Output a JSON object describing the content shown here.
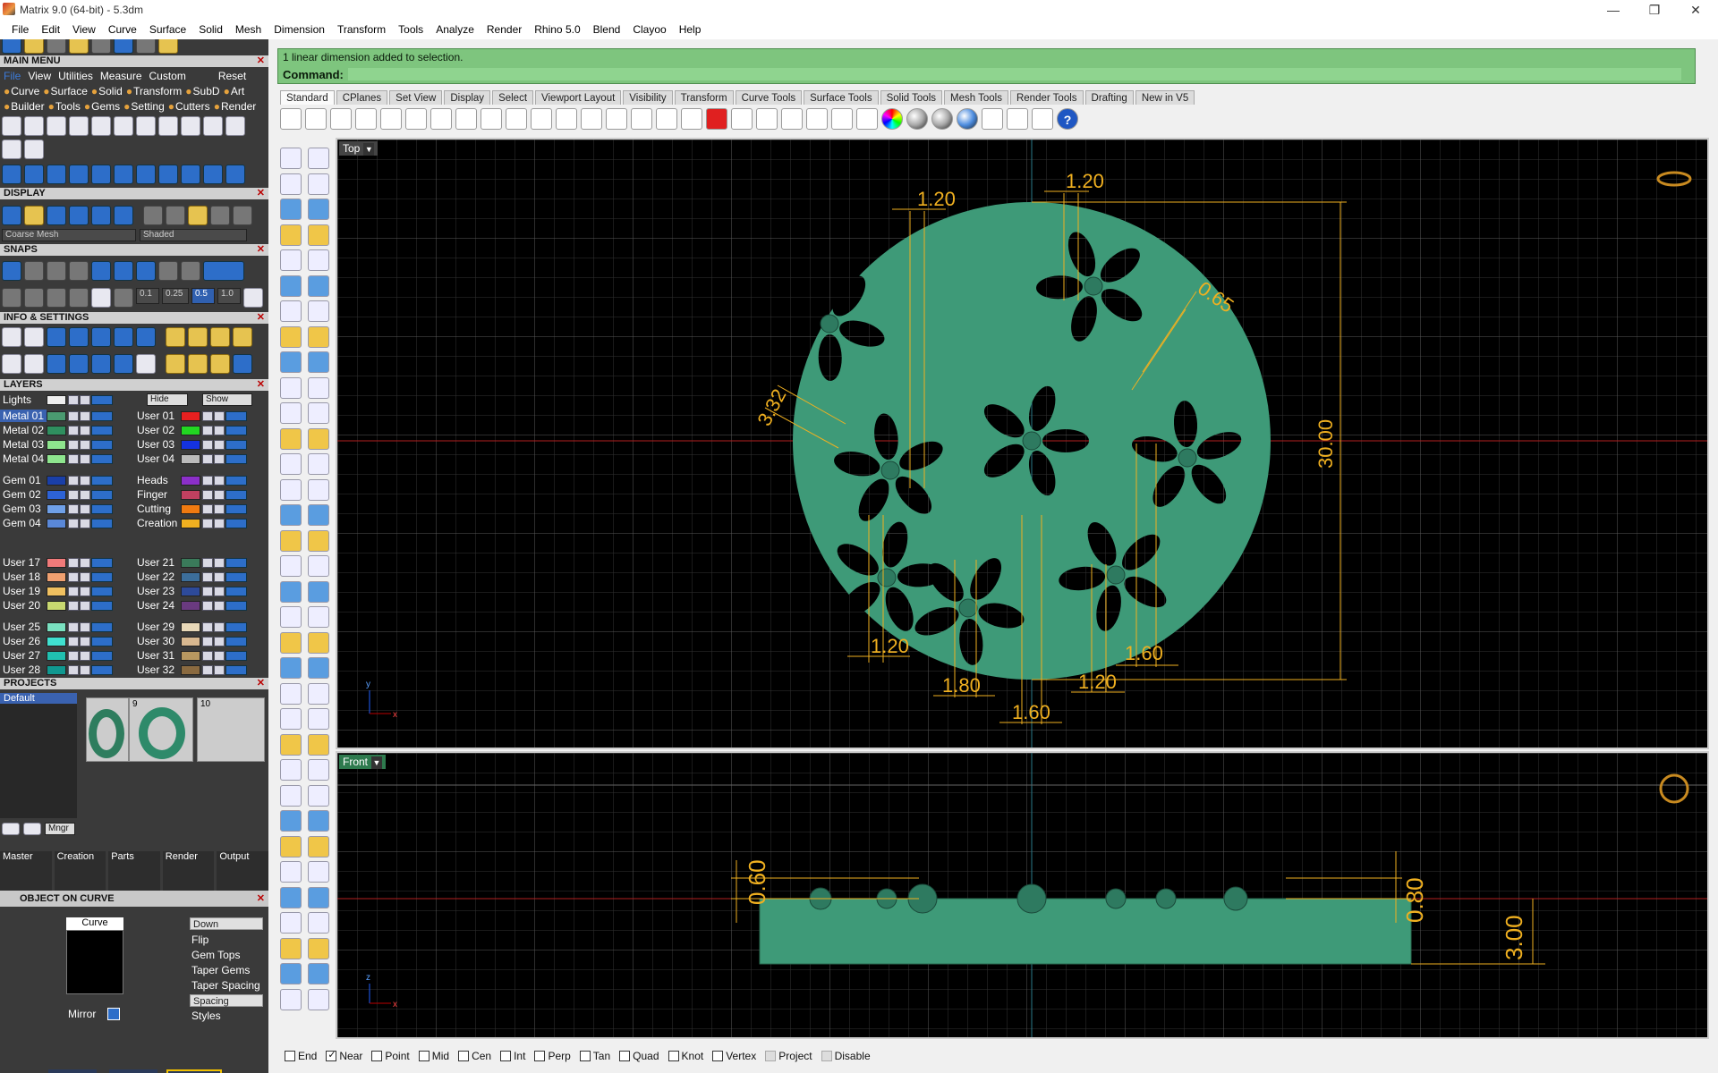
{
  "window": {
    "title": "Matrix 9.0 (64-bit) - 5.3dm",
    "minimize": "—",
    "restore": "❐",
    "close": "✕"
  },
  "menu": [
    "File",
    "Edit",
    "View",
    "Curve",
    "Surface",
    "Solid",
    "Mesh",
    "Dimension",
    "Transform",
    "Tools",
    "Analyze",
    "Render",
    "Rhino 5.0",
    "Blend",
    "Clayoo",
    "Help"
  ],
  "main_menu": {
    "title": "MAIN MENU",
    "row1": [
      "File",
      "View",
      "Utilities",
      "Measure",
      "Custom",
      "Reset"
    ],
    "row2": [
      "Curve",
      "Surface",
      "Solid",
      "Transform",
      "SubD",
      "Art"
    ],
    "row3": [
      "Builder",
      "Tools",
      "Gems",
      "Setting",
      "Cutters",
      "Render"
    ]
  },
  "display": {
    "title": "DISPLAY",
    "mesh_combo": "Coarse Mesh",
    "shade_combo": "Shaded"
  },
  "snaps": {
    "title": "SNAPS",
    "values": [
      "0.1",
      "0.25",
      "0.5",
      "1.0"
    ]
  },
  "info": {
    "title": "INFO & SETTINGS"
  },
  "layers": {
    "title": "LAYERS",
    "lights": "Lights",
    "hide": "Hide",
    "show": "Show",
    "left_group1": [
      {
        "name": "Metal 01",
        "color": "#4a9a70"
      },
      {
        "name": "Metal 02",
        "color": "#2f8f5f"
      },
      {
        "name": "Metal 03",
        "color": "#8ee58e"
      },
      {
        "name": "Metal 04",
        "color": "#8ee58e"
      }
    ],
    "right_group1": [
      {
        "name": "User 01",
        "color": "#e82020"
      },
      {
        "name": "User 02",
        "color": "#22d722"
      },
      {
        "name": "User 03",
        "color": "#1432e0"
      },
      {
        "name": "User 04",
        "color": "#bbbbbb"
      }
    ],
    "left_group2": [
      {
        "name": "Gem 01",
        "color": "#1a3fa8"
      },
      {
        "name": "Gem 02",
        "color": "#2d62d6"
      },
      {
        "name": "Gem 03",
        "color": "#6fa0e8"
      },
      {
        "name": "Gem 04",
        "color": "#5a88d8"
      }
    ],
    "right_group2": [
      {
        "name": "Heads",
        "color": "#8b2fc9"
      },
      {
        "name": "Finger",
        "color": "#c04060"
      },
      {
        "name": "Cutting",
        "color": "#f07a10"
      },
      {
        "name": "Creation",
        "color": "#f0b020"
      }
    ],
    "left_group3": [
      {
        "name": "User 17",
        "color": "#f07a7a"
      },
      {
        "name": "User 18",
        "color": "#f0a070"
      },
      {
        "name": "User 19",
        "color": "#f0c060"
      },
      {
        "name": "User 20",
        "color": "#c8d870"
      }
    ],
    "right_group3": [
      {
        "name": "User 21",
        "color": "#3a7a5a"
      },
      {
        "name": "User 22",
        "color": "#3c6e9a"
      },
      {
        "name": "User 23",
        "color": "#2d4a9a"
      },
      {
        "name": "User 24",
        "color": "#6a3a80"
      }
    ],
    "left_group4": [
      {
        "name": "User 25",
        "color": "#7ae0c0"
      },
      {
        "name": "User 26",
        "color": "#40e0d0"
      },
      {
        "name": "User 27",
        "color": "#20c0b0"
      },
      {
        "name": "User 28",
        "color": "#109890"
      }
    ],
    "right_group4": [
      {
        "name": "User 29",
        "color": "#e8d8b8"
      },
      {
        "name": "User 30",
        "color": "#d8b890"
      },
      {
        "name": "User 31",
        "color": "#b89860"
      },
      {
        "name": "User 32",
        "color": "#8a6a40"
      }
    ]
  },
  "projects": {
    "title": "PROJECTS",
    "default": "Default",
    "thumb_nums": [
      "9",
      "10"
    ],
    "mngr": "Mngr",
    "sections": [
      "Master",
      "Creation",
      "Parts",
      "Render",
      "Output"
    ]
  },
  "ooc": {
    "title": "OBJECT ON CURVE",
    "curve_label": "Curve",
    "mirror": "Mirror",
    "options": [
      "Down",
      "Flip",
      "Gem Tops",
      "Taper Gems",
      "Taper Spacing",
      "Spacing",
      "Styles"
    ]
  },
  "command": {
    "history": "1 linear dimension added to selection.",
    "prompt": "Command:"
  },
  "tabs": [
    "Standard",
    "CPlanes",
    "Set View",
    "Display",
    "Select",
    "Viewport Layout",
    "Visibility",
    "Transform",
    "Curve Tools",
    "Surface Tools",
    "Solid Tools",
    "Mesh Tools",
    "Render Tools",
    "Drafting",
    "New in V5"
  ],
  "viewports": {
    "top_label": "Top",
    "front_label": "Front",
    "top_dims": {
      "d_120_a": "1.20",
      "d_120_b": "1.20",
      "d_065": "0.65",
      "d_332": "3.32",
      "d_3000": "30.00",
      "d_120_c": "1.20",
      "d_180": "1.80",
      "d_160_a": "1.60",
      "d_120_d": "1.20",
      "d_160_b": "1.60"
    },
    "front_dims": {
      "d_060": "0.60",
      "d_080": "0.80",
      "d_300": "3.00"
    },
    "axis_y": "y",
    "axis_x": "x",
    "axis_z": "z"
  },
  "osnap": [
    {
      "label": "End",
      "on": false
    },
    {
      "label": "Near",
      "on": true
    },
    {
      "label": "Point",
      "on": false
    },
    {
      "label": "Mid",
      "on": false
    },
    {
      "label": "Cen",
      "on": false
    },
    {
      "label": "Int",
      "on": false
    },
    {
      "label": "Perp",
      "on": false
    },
    {
      "label": "Tan",
      "on": false
    },
    {
      "label": "Quad",
      "on": false
    },
    {
      "label": "Knot",
      "on": false
    },
    {
      "label": "Vertex",
      "on": false
    },
    {
      "label": "Project",
      "on": false,
      "dim": true
    },
    {
      "label": "Disable",
      "on": false,
      "dim": true
    }
  ],
  "colors": {
    "model": "#3e9a78",
    "dim": "#f0b020",
    "grid": "#3a3a3a",
    "cmd_bg": "#7ec57e"
  }
}
